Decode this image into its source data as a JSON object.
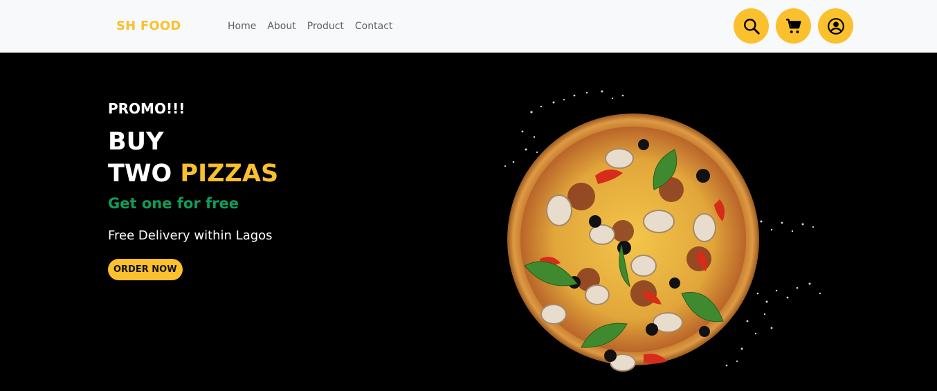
{
  "brand": "SH FOOD",
  "nav": {
    "links": [
      "Home",
      "About",
      "Product",
      "Contact"
    ]
  },
  "icons": {
    "search": "search-icon",
    "cart": "cart-icon",
    "account": "user-circle-icon"
  },
  "hero": {
    "promo": "PROMO!!!",
    "headline_line1": "BUY",
    "headline_line2_white": "TWO",
    "headline_line2_accent": "PIZZAS",
    "subhead": "Get one for free",
    "delivery": "Free Delivery within Lagos",
    "cta": "ORDER NOW"
  },
  "colors": {
    "accent": "#fbc02d",
    "green": "#0f9d58",
    "nav_bg": "#f8f9fa",
    "hero_bg": "#000000"
  }
}
